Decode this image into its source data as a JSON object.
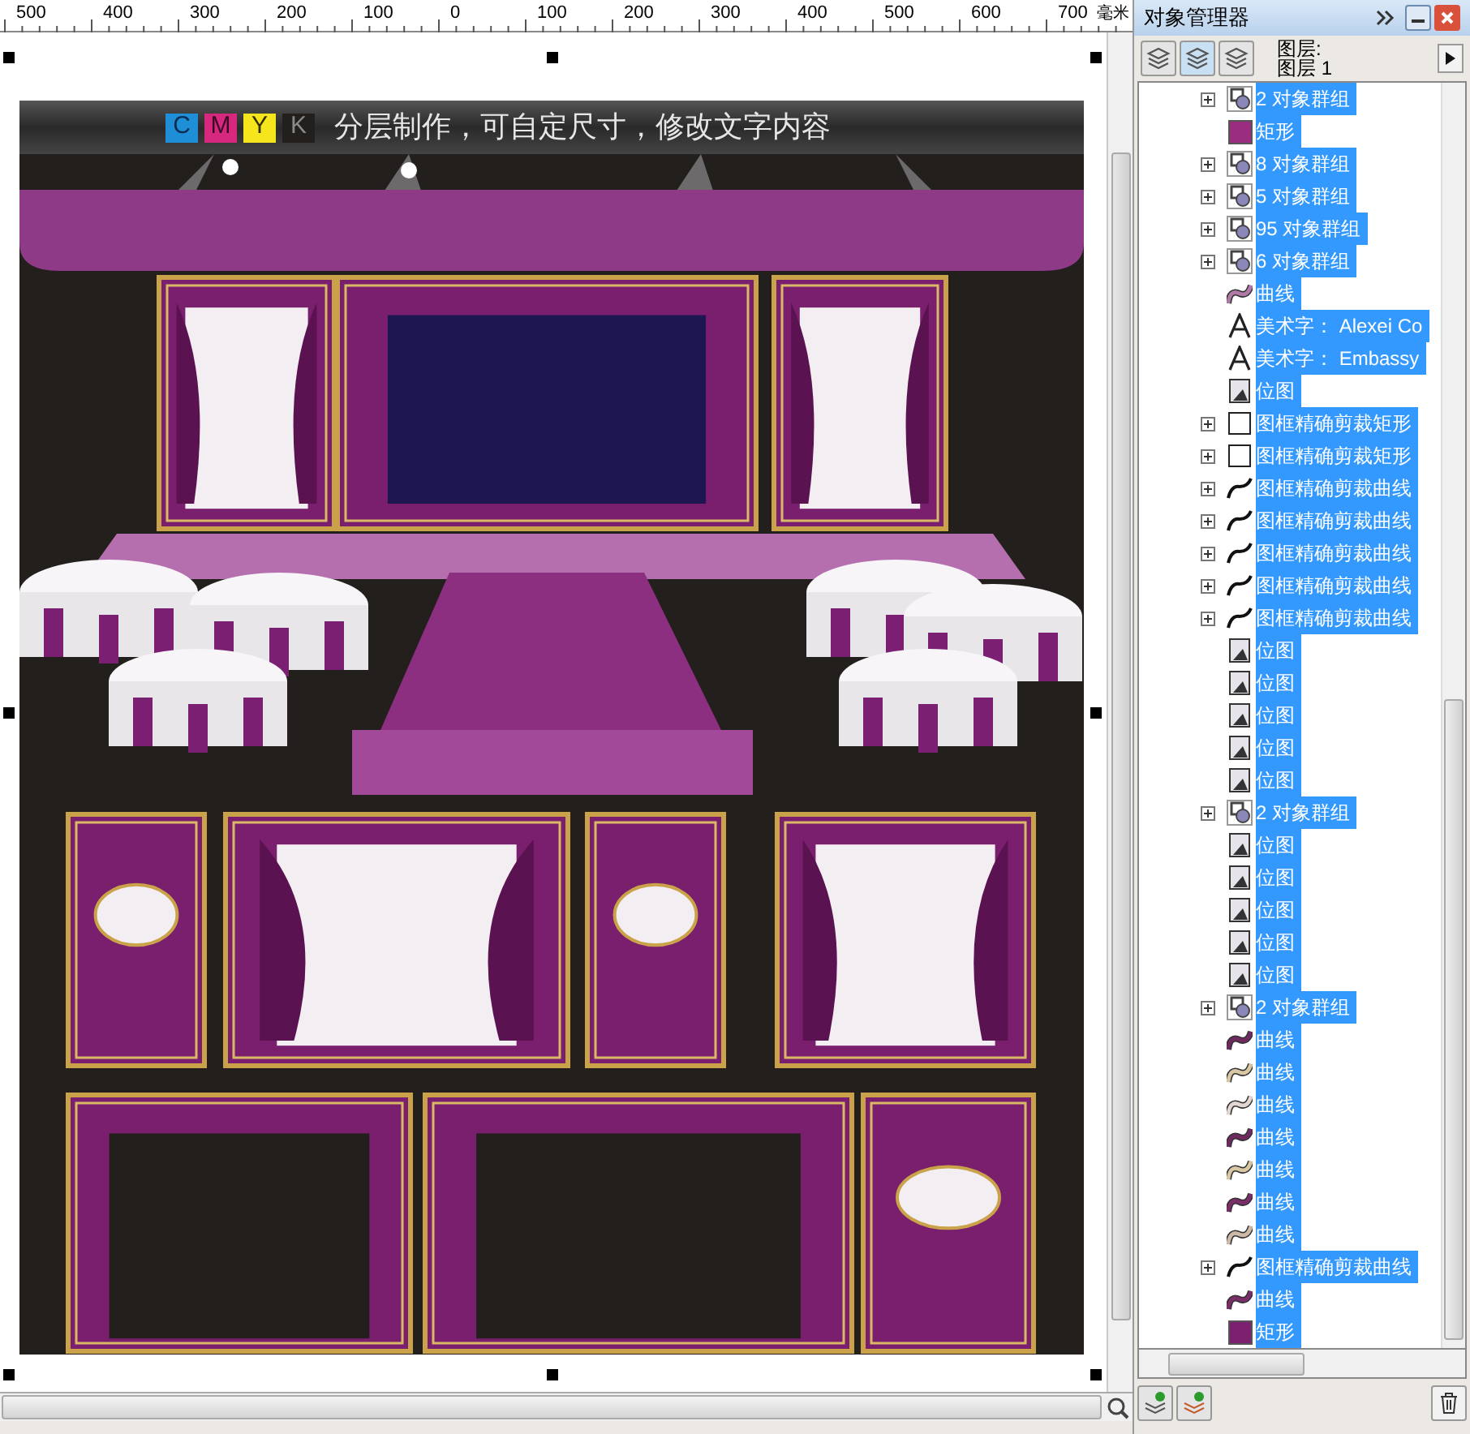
{
  "ruler": {
    "labels": [
      "500",
      "400",
      "300",
      "200",
      "100",
      "0",
      "100",
      "200",
      "300",
      "400",
      "500",
      "600",
      "700"
    ],
    "unit": "毫米"
  },
  "artwork": {
    "cmyk": [
      "C",
      "M",
      "Y",
      "K"
    ],
    "banner": "分层制作，可自定尺寸，修改文字内容"
  },
  "object_manager": {
    "title": "对象管理器",
    "layer_label": "图层:",
    "layer_name": "图层 1",
    "items": [
      {
        "kind": "group",
        "label": "2 对象群组",
        "expanded": false,
        "selected": true
      },
      {
        "kind": "rect",
        "label": "矩形",
        "color": "#9b2d7f",
        "selected": true
      },
      {
        "kind": "group",
        "label": "8 对象群组",
        "expanded": false,
        "selected": true
      },
      {
        "kind": "group",
        "label": "5 对象群组",
        "expanded": false,
        "selected": true
      },
      {
        "kind": "group",
        "label": "95 对象群组",
        "expanded": false,
        "selected": true
      },
      {
        "kind": "group",
        "label": "6 对象群组",
        "expanded": false,
        "selected": true
      },
      {
        "kind": "curve",
        "label": "曲线",
        "color": "#b07aa8",
        "selected": true
      },
      {
        "kind": "text",
        "label": "美术字： Alexei Co",
        "selected": true
      },
      {
        "kind": "text",
        "label": "美术字： Embassy",
        "selected": true
      },
      {
        "kind": "bitmap",
        "label": "位图",
        "selected": true
      },
      {
        "kind": "clip_rect",
        "label": "图框精确剪裁矩形",
        "expanded": false,
        "selected": true
      },
      {
        "kind": "clip_rect",
        "label": "图框精确剪裁矩形",
        "expanded": false,
        "selected": true
      },
      {
        "kind": "clip_curve",
        "label": "图框精确剪裁曲线",
        "expanded": false,
        "selected": true
      },
      {
        "kind": "clip_curve",
        "label": "图框精确剪裁曲线",
        "expanded": false,
        "selected": true
      },
      {
        "kind": "clip_curve",
        "label": "图框精确剪裁曲线",
        "expanded": false,
        "selected": true
      },
      {
        "kind": "clip_curve",
        "label": "图框精确剪裁曲线",
        "expanded": false,
        "selected": true
      },
      {
        "kind": "clip_curve",
        "label": "图框精确剪裁曲线",
        "expanded": false,
        "selected": true
      },
      {
        "kind": "bitmap",
        "label": "位图",
        "selected": true
      },
      {
        "kind": "bitmap",
        "label": "位图",
        "selected": true
      },
      {
        "kind": "bitmap",
        "label": "位图",
        "selected": true
      },
      {
        "kind": "bitmap",
        "label": "位图",
        "selected": true
      },
      {
        "kind": "bitmap",
        "label": "位图",
        "selected": true
      },
      {
        "kind": "group",
        "label": "2 对象群组",
        "expanded": false,
        "selected": true
      },
      {
        "kind": "bitmap",
        "label": "位图",
        "selected": true
      },
      {
        "kind": "bitmap",
        "label": "位图",
        "selected": true
      },
      {
        "kind": "bitmap",
        "label": "位图",
        "selected": true
      },
      {
        "kind": "bitmap",
        "label": "位图",
        "selected": true
      },
      {
        "kind": "bitmap",
        "label": "位图",
        "selected": true
      },
      {
        "kind": "group",
        "label": "2 对象群组",
        "expanded": false,
        "selected": true
      },
      {
        "kind": "curve",
        "label": "曲线",
        "color": "#6e2a5e",
        "selected": true
      },
      {
        "kind": "curve",
        "label": "曲线",
        "color": "#d8c7a3",
        "selected": true
      },
      {
        "kind": "curve",
        "label": "曲线",
        "color": "#e3d6d0",
        "selected": true
      },
      {
        "kind": "curve",
        "label": "曲线",
        "color": "#6e2a5e",
        "selected": true
      },
      {
        "kind": "curve",
        "label": "曲线",
        "color": "#d8c7a3",
        "selected": true
      },
      {
        "kind": "curve",
        "label": "曲线",
        "color": "#7a2d68",
        "selected": true
      },
      {
        "kind": "curve",
        "label": "曲线",
        "color": "#cdb9a8",
        "selected": true
      },
      {
        "kind": "clip_curve",
        "label": "图框精确剪裁曲线",
        "expanded": false,
        "selected": true
      },
      {
        "kind": "curve",
        "label": "曲线",
        "color": "#7a2d68",
        "selected": true
      },
      {
        "kind": "rect",
        "label": "矩形",
        "color": "#7d2070",
        "selected": true
      }
    ]
  }
}
